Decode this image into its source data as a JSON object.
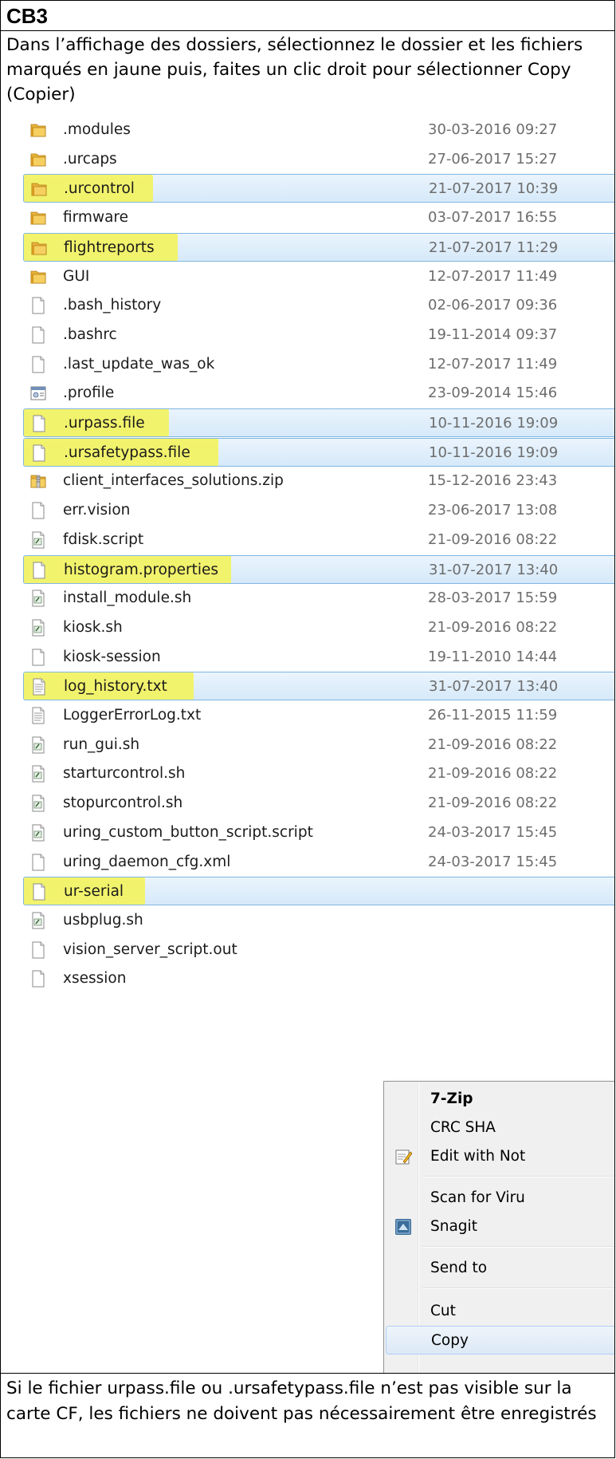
{
  "title": "CB3",
  "instruction": "Dans l’affichage des dossiers, sélectionnez le dossier et les fichiers marqués en jaune puis, faites un clic droit pour sélectionner Copy (Copier)",
  "note": "Si le fichier urpass.file ou .ursafetypass.file n’est pas visible sur la carte CF, les fichiers ne doivent pas nécessairement être enregistrés",
  "colors": {
    "highlight": "#f3f35f",
    "selection": "#d6e9f9",
    "selection_border": "#80b5e2",
    "folder": "#e8b23a",
    "date_text": "#6d6d6d"
  },
  "files": [
    {
      "name": ".modules",
      "date": "30-03-2016 09:27",
      "icon": "folder-icon",
      "selected": false,
      "highlighted": false
    },
    {
      "name": ".urcaps",
      "date": "27-06-2017 15:27",
      "icon": "folder-icon",
      "selected": false,
      "highlighted": false
    },
    {
      "name": ".urcontrol",
      "date": "21-07-2017 10:39",
      "icon": "folder-icon",
      "selected": true,
      "highlighted": true
    },
    {
      "name": "firmware",
      "date": "03-07-2017 16:55",
      "icon": "folder-icon",
      "selected": false,
      "highlighted": false
    },
    {
      "name": "flightreports",
      "date": "21-07-2017 11:29",
      "icon": "folder-icon",
      "selected": true,
      "highlighted": true
    },
    {
      "name": "GUI",
      "date": "12-07-2017 11:49",
      "icon": "folder-icon",
      "selected": false,
      "highlighted": false
    },
    {
      "name": ".bash_history",
      "date": "02-06-2017 09:36",
      "icon": "blank-file-icon",
      "selected": false,
      "highlighted": false
    },
    {
      "name": ".bashrc",
      "date": "19-11-2014 09:37",
      "icon": "blank-file-icon",
      "selected": false,
      "highlighted": false
    },
    {
      "name": ".last_update_was_ok",
      "date": "12-07-2017 11:49",
      "icon": "blank-file-icon",
      "selected": false,
      "highlighted": false
    },
    {
      "name": ".profile",
      "date": "23-09-2014 15:46",
      "icon": "settings-file-icon",
      "selected": false,
      "highlighted": false
    },
    {
      "name": ".urpass.file",
      "date": "10-11-2016 19:09",
      "icon": "blank-file-icon",
      "selected": true,
      "highlighted": true
    },
    {
      "name": ".ursafetypass.file",
      "date": "10-11-2016 19:09",
      "icon": "blank-file-icon",
      "selected": true,
      "highlighted": true
    },
    {
      "name": "client_interfaces_solutions.zip",
      "date": "15-12-2016 23:43",
      "icon": "zip-folder-icon",
      "selected": false,
      "highlighted": false
    },
    {
      "name": "err.vision",
      "date": "23-06-2017 13:08",
      "icon": "blank-file-icon",
      "selected": false,
      "highlighted": false
    },
    {
      "name": "fdisk.script",
      "date": "21-09-2016 08:22",
      "icon": "script-file-icon",
      "selected": false,
      "highlighted": false
    },
    {
      "name": "histogram.properties",
      "date": "31-07-2017 13:40",
      "icon": "blank-file-icon",
      "selected": true,
      "highlighted": true
    },
    {
      "name": "install_module.sh",
      "date": "28-03-2017 15:59",
      "icon": "script-file-icon",
      "selected": false,
      "highlighted": false
    },
    {
      "name": "kiosk.sh",
      "date": "21-09-2016 08:22",
      "icon": "script-file-icon",
      "selected": false,
      "highlighted": false
    },
    {
      "name": "kiosk-session",
      "date": "19-11-2010 14:44",
      "icon": "blank-file-icon",
      "selected": false,
      "highlighted": false
    },
    {
      "name": "log_history.txt",
      "date": "31-07-2017 13:40",
      "icon": "text-file-icon",
      "selected": true,
      "highlighted": true
    },
    {
      "name": "LoggerErrorLog.txt",
      "date": "26-11-2015 11:59",
      "icon": "text-file-icon",
      "selected": false,
      "highlighted": false
    },
    {
      "name": "run_gui.sh",
      "date": "21-09-2016 08:22",
      "icon": "script-file-icon",
      "selected": false,
      "highlighted": false
    },
    {
      "name": "starturcontrol.sh",
      "date": "21-09-2016 08:22",
      "icon": "script-file-icon",
      "selected": false,
      "highlighted": false
    },
    {
      "name": "stopurcontrol.sh",
      "date": "21-09-2016 08:22",
      "icon": "script-file-icon",
      "selected": false,
      "highlighted": false
    },
    {
      "name": "uring_custom_button_script.script",
      "date": "24-03-2017 15:45",
      "icon": "script-file-icon",
      "selected": false,
      "highlighted": false
    },
    {
      "name": "uring_daemon_cfg.xml",
      "date": "24-03-2017 15:45",
      "icon": "blank-file-icon",
      "selected": false,
      "highlighted": false
    },
    {
      "name": "ur-serial",
      "date": "",
      "icon": "blank-file-icon",
      "selected": true,
      "highlighted": true
    },
    {
      "name": "usbplug.sh",
      "date": "",
      "icon": "script-file-icon",
      "selected": false,
      "highlighted": false
    },
    {
      "name": "vision_server_script.out",
      "date": "",
      "icon": "blank-file-icon",
      "selected": false,
      "highlighted": false
    },
    {
      "name": "xsession",
      "date": "",
      "icon": "blank-file-icon",
      "selected": false,
      "highlighted": false
    }
  ],
  "context_menu": {
    "items": [
      {
        "label": "7-Zip",
        "bold": true,
        "icon": "",
        "hover": false
      },
      {
        "label": "CRC SHA",
        "bold": false,
        "icon": "",
        "hover": false
      },
      {
        "label": "Edit with Not",
        "bold": false,
        "icon": "notepad-edit-icon",
        "hover": false
      },
      {
        "label": "Scan for Viru",
        "bold": false,
        "icon": "",
        "hover": false
      },
      {
        "label": "Snagit",
        "bold": false,
        "icon": "snagit-icon",
        "hover": false
      },
      {
        "label": "Send to",
        "bold": false,
        "icon": "",
        "hover": false
      },
      {
        "label": "Cut",
        "bold": false,
        "icon": "",
        "hover": false
      },
      {
        "label": "Copy",
        "bold": false,
        "icon": "",
        "hover": true
      }
    ]
  }
}
